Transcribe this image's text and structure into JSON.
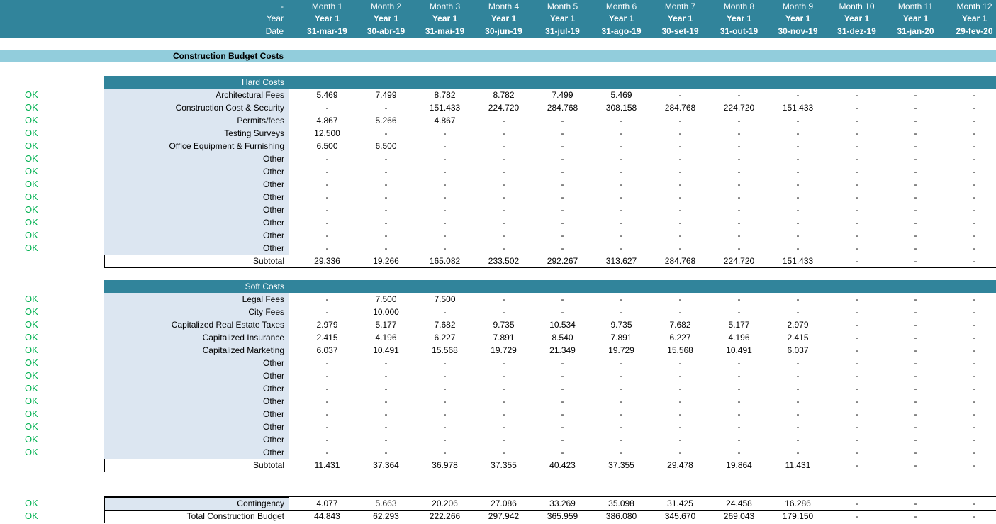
{
  "header": {
    "row1_label": "-",
    "row2_label": "Year",
    "row3_label": "Date",
    "months": [
      "Month 1",
      "Month 2",
      "Month 3",
      "Month 4",
      "Month 5",
      "Month 6",
      "Month 7",
      "Month 8",
      "Month 9",
      "Month 10",
      "Month 11",
      "Month 12"
    ],
    "years": [
      "Year 1",
      "Year 1",
      "Year 1",
      "Year 1",
      "Year 1",
      "Year 1",
      "Year 1",
      "Year 1",
      "Year 1",
      "Year 1",
      "Year 1",
      "Year 1"
    ],
    "dates": [
      "31-mar-19",
      "30-abr-19",
      "31-mai-19",
      "30-jun-19",
      "31-jul-19",
      "31-ago-19",
      "30-set-19",
      "31-out-19",
      "30-nov-19",
      "31-dez-19",
      "31-jan-20",
      "29-fev-20"
    ]
  },
  "section_title": "Construction Budget Costs",
  "hard_costs": {
    "title": "Hard Costs",
    "rows": [
      {
        "status": "OK",
        "label": "Architectural Fees",
        "values": [
          "5.469",
          "7.499",
          "8.782",
          "8.782",
          "7.499",
          "5.469",
          "-",
          "-",
          "-",
          "-",
          "-",
          "-"
        ]
      },
      {
        "status": "OK",
        "label": "Construction Cost & Security",
        "values": [
          "-",
          "-",
          "151.433",
          "224.720",
          "284.768",
          "308.158",
          "284.768",
          "224.720",
          "151.433",
          "-",
          "-",
          "-"
        ]
      },
      {
        "status": "OK",
        "label": "Permits/fees",
        "values": [
          "4.867",
          "5.266",
          "4.867",
          "-",
          "-",
          "-",
          "-",
          "-",
          "-",
          "-",
          "-",
          "-"
        ]
      },
      {
        "status": "OK",
        "label": "Testing Surveys",
        "values": [
          "12.500",
          "-",
          "-",
          "-",
          "-",
          "-",
          "-",
          "-",
          "-",
          "-",
          "-",
          "-"
        ]
      },
      {
        "status": "OK",
        "label": "Office Equipment & Furnishing",
        "values": [
          "6.500",
          "6.500",
          "-",
          "-",
          "-",
          "-",
          "-",
          "-",
          "-",
          "-",
          "-",
          "-"
        ]
      },
      {
        "status": "OK",
        "label": "Other",
        "values": [
          "-",
          "-",
          "-",
          "-",
          "-",
          "-",
          "-",
          "-",
          "-",
          "-",
          "-",
          "-"
        ]
      },
      {
        "status": "OK",
        "label": "Other",
        "values": [
          "-",
          "-",
          "-",
          "-",
          "-",
          "-",
          "-",
          "-",
          "-",
          "-",
          "-",
          "-"
        ]
      },
      {
        "status": "OK",
        "label": "Other",
        "values": [
          "-",
          "-",
          "-",
          "-",
          "-",
          "-",
          "-",
          "-",
          "-",
          "-",
          "-",
          "-"
        ]
      },
      {
        "status": "OK",
        "label": "Other",
        "values": [
          "-",
          "-",
          "-",
          "-",
          "-",
          "-",
          "-",
          "-",
          "-",
          "-",
          "-",
          "-"
        ]
      },
      {
        "status": "OK",
        "label": "Other",
        "values": [
          "-",
          "-",
          "-",
          "-",
          "-",
          "-",
          "-",
          "-",
          "-",
          "-",
          "-",
          "-"
        ]
      },
      {
        "status": "OK",
        "label": "Other",
        "values": [
          "-",
          "-",
          "-",
          "-",
          "-",
          "-",
          "-",
          "-",
          "-",
          "-",
          "-",
          "-"
        ]
      },
      {
        "status": "OK",
        "label": "Other",
        "values": [
          "-",
          "-",
          "-",
          "-",
          "-",
          "-",
          "-",
          "-",
          "-",
          "-",
          "-",
          "-"
        ]
      },
      {
        "status": "OK",
        "label": "Other",
        "values": [
          "-",
          "-",
          "-",
          "-",
          "-",
          "-",
          "-",
          "-",
          "-",
          "-",
          "-",
          "-"
        ]
      }
    ],
    "subtotal": {
      "label": "Subtotal",
      "values": [
        "29.336",
        "19.266",
        "165.082",
        "233.502",
        "292.267",
        "313.627",
        "284.768",
        "224.720",
        "151.433",
        "-",
        "-",
        "-"
      ]
    }
  },
  "soft_costs": {
    "title": "Soft Costs",
    "rows": [
      {
        "status": "OK",
        "label": "Legal Fees",
        "values": [
          "-",
          "7.500",
          "7.500",
          "-",
          "-",
          "-",
          "-",
          "-",
          "-",
          "-",
          "-",
          "-"
        ]
      },
      {
        "status": "OK",
        "label": "City Fees",
        "values": [
          "-",
          "10.000",
          "-",
          "-",
          "-",
          "-",
          "-",
          "-",
          "-",
          "-",
          "-",
          "-"
        ]
      },
      {
        "status": "OK",
        "label": "Capitalized Real Estate Taxes",
        "values": [
          "2.979",
          "5.177",
          "7.682",
          "9.735",
          "10.534",
          "9.735",
          "7.682",
          "5.177",
          "2.979",
          "-",
          "-",
          "-"
        ]
      },
      {
        "status": "OK",
        "label": "Capitalized Insurance",
        "values": [
          "2.415",
          "4.196",
          "6.227",
          "7.891",
          "8.540",
          "7.891",
          "6.227",
          "4.196",
          "2.415",
          "-",
          "-",
          "-"
        ]
      },
      {
        "status": "OK",
        "label": "Capitalized Marketing",
        "values": [
          "6.037",
          "10.491",
          "15.568",
          "19.729",
          "21.349",
          "19.729",
          "15.568",
          "10.491",
          "6.037",
          "-",
          "-",
          "-"
        ]
      },
      {
        "status": "OK",
        "label": "Other",
        "values": [
          "-",
          "-",
          "-",
          "-",
          "-",
          "-",
          "-",
          "-",
          "-",
          "-",
          "-",
          "-"
        ]
      },
      {
        "status": "OK",
        "label": "Other",
        "values": [
          "-",
          "-",
          "-",
          "-",
          "-",
          "-",
          "-",
          "-",
          "-",
          "-",
          "-",
          "-"
        ]
      },
      {
        "status": "OK",
        "label": "Other",
        "values": [
          "-",
          "-",
          "-",
          "-",
          "-",
          "-",
          "-",
          "-",
          "-",
          "-",
          "-",
          "-"
        ]
      },
      {
        "status": "OK",
        "label": "Other",
        "values": [
          "-",
          "-",
          "-",
          "-",
          "-",
          "-",
          "-",
          "-",
          "-",
          "-",
          "-",
          "-"
        ]
      },
      {
        "status": "OK",
        "label": "Other",
        "values": [
          "-",
          "-",
          "-",
          "-",
          "-",
          "-",
          "-",
          "-",
          "-",
          "-",
          "-",
          "-"
        ]
      },
      {
        "status": "OK",
        "label": "Other",
        "values": [
          "-",
          "-",
          "-",
          "-",
          "-",
          "-",
          "-",
          "-",
          "-",
          "-",
          "-",
          "-"
        ]
      },
      {
        "status": "OK",
        "label": "Other",
        "values": [
          "-",
          "-",
          "-",
          "-",
          "-",
          "-",
          "-",
          "-",
          "-",
          "-",
          "-",
          "-"
        ]
      },
      {
        "status": "OK",
        "label": "Other",
        "values": [
          "-",
          "-",
          "-",
          "-",
          "-",
          "-",
          "-",
          "-",
          "-",
          "-",
          "-",
          "-"
        ]
      }
    ],
    "subtotal": {
      "label": "Subtotal",
      "values": [
        "11.431",
        "37.364",
        "36.978",
        "37.355",
        "40.423",
        "37.355",
        "29.478",
        "19.864",
        "11.431",
        "-",
        "-",
        "-"
      ]
    }
  },
  "contingency": {
    "status": "OK",
    "label": "Contingency",
    "values": [
      "4.077",
      "5.663",
      "20.206",
      "27.086",
      "33.269",
      "35.098",
      "31.425",
      "24.458",
      "16.286",
      "-",
      "-",
      "-"
    ]
  },
  "total": {
    "status": "OK",
    "label": "Total Construction Budget",
    "values": [
      "44.843",
      "62.293",
      "222.266",
      "297.942",
      "365.959",
      "386.080",
      "345.670",
      "269.043",
      "179.150",
      "-",
      "-",
      "-"
    ]
  },
  "colors": {
    "header_bg": "#31849b",
    "section_band": "#92cddc",
    "label_panel": "#dce6f1",
    "ok_green": "#00b050"
  }
}
